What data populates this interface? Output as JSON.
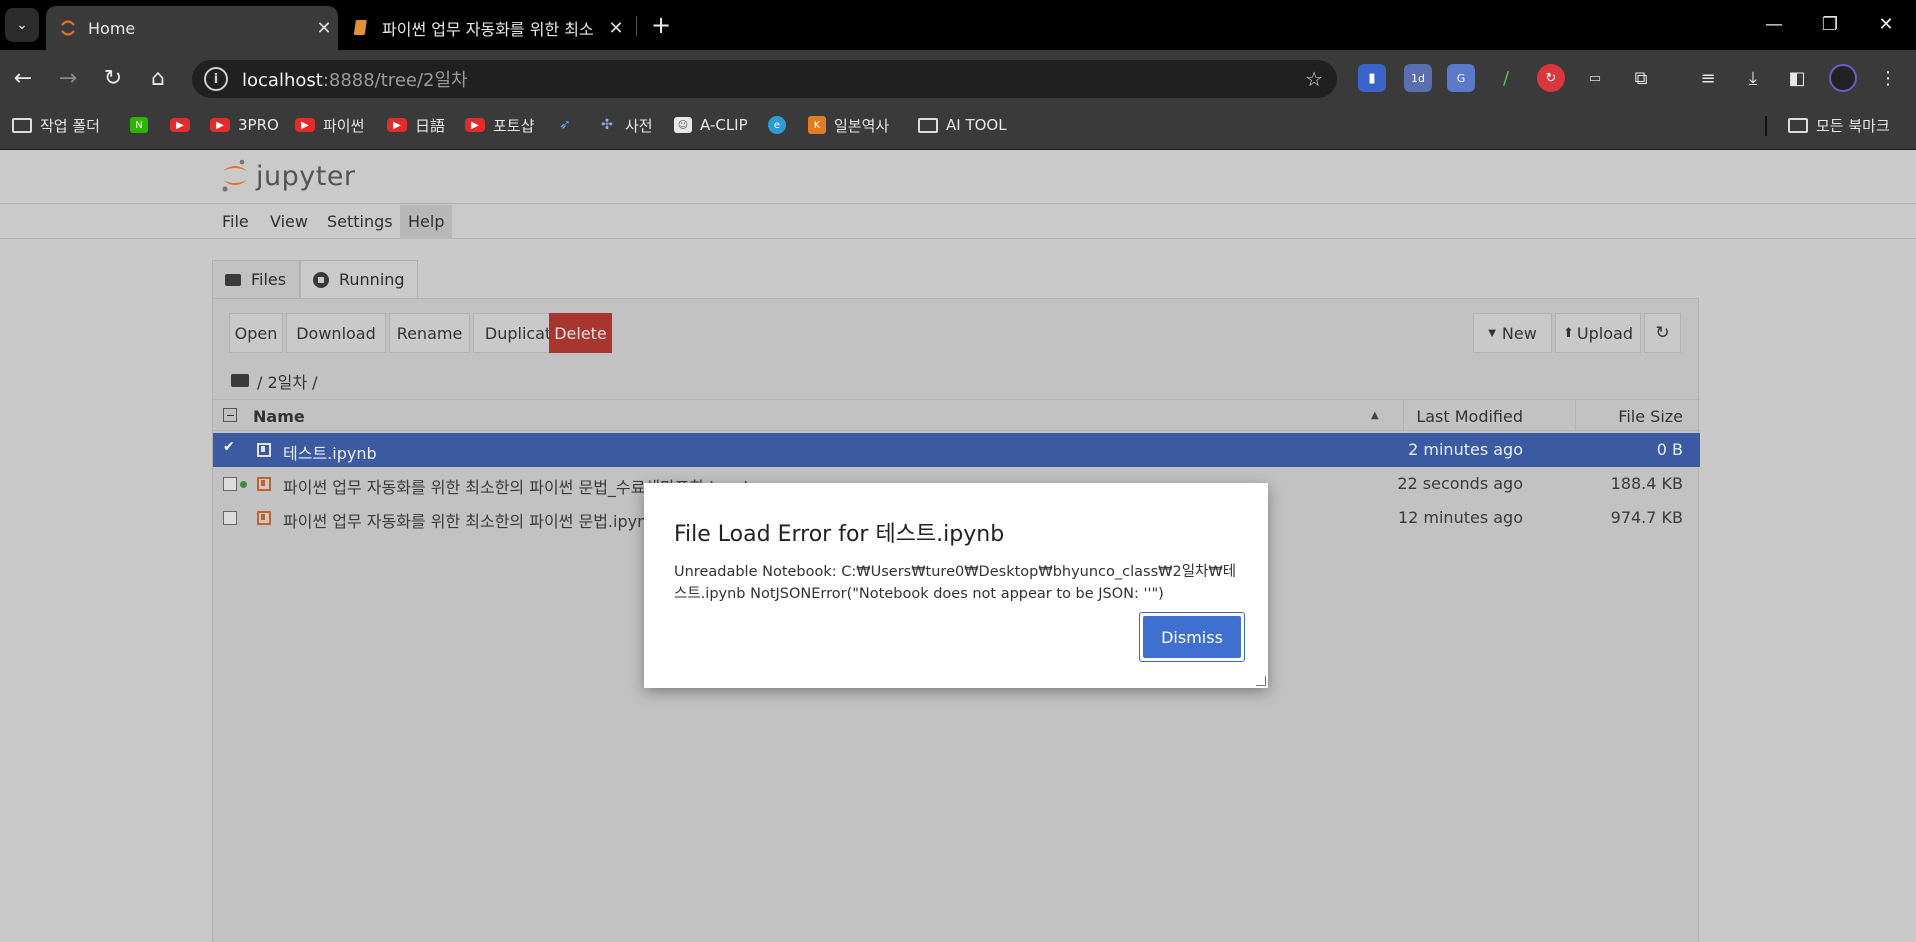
{
  "browser": {
    "tabs": [
      {
        "title": "Home",
        "active": true
      },
      {
        "title": "파이썬 업무 자동화를 위한 최소",
        "active": false
      }
    ],
    "url_host": "localhost",
    "url_path": ":8888/tree/2일차",
    "bookmarks": [
      {
        "label": "작업 폴더",
        "icon": "folder-icon"
      },
      {
        "label": "",
        "icon": "naver-icon"
      },
      {
        "label": "",
        "icon": "youtube-icon"
      },
      {
        "label": "3PRO",
        "icon": "youtube-icon"
      },
      {
        "label": "파이썬",
        "icon": "youtube-icon"
      },
      {
        "label": "日語",
        "icon": "youtube-icon"
      },
      {
        "label": "포토샵",
        "icon": "youtube-icon"
      },
      {
        "label": "",
        "icon": "bird-icon"
      },
      {
        "label": "사전",
        "icon": "dictionary-icon"
      },
      {
        "label": "A-CLIP",
        "icon": "aclip-icon"
      },
      {
        "label": "",
        "icon": "edge-icon"
      },
      {
        "label": "일본역사",
        "icon": "k-icon"
      },
      {
        "label": "AI TOOL",
        "icon": "folder-icon"
      }
    ],
    "all_bookmarks": "모든 북마크"
  },
  "jupyter": {
    "logo": "jupyter",
    "menu": [
      "File",
      "View",
      "Settings",
      "Help"
    ],
    "tabs": [
      "Files",
      "Running"
    ],
    "toolbar": {
      "open": "Open",
      "download": "Download",
      "rename": "Rename",
      "duplicate": "Duplicate",
      "delete": "Delete",
      "new": "New",
      "upload": "Upload"
    },
    "breadcrumb": "/ 2일차 /",
    "columns": {
      "name": "Name",
      "last_modified": "Last Modified",
      "file_size": "File Size"
    },
    "files": [
      {
        "name": "테스트.ipynb",
        "modified": "2 minutes ago",
        "size": "0 B",
        "selected": true,
        "running": false
      },
      {
        "name": "파이썬 업무 자동화를 위한 최소한의 파이썬 문법_수료생만포함.ipynb",
        "modified": "22 seconds ago",
        "size": "188.4 KB",
        "selected": false,
        "running": true
      },
      {
        "name": "파이썬 업무 자동화를 위한 최소한의 파이썬 문법.ipynb",
        "modified": "12 minutes ago",
        "size": "974.7 KB",
        "selected": false,
        "running": false
      }
    ]
  },
  "dialog": {
    "title": "File Load Error for 테스트.ipynb",
    "message": "Unreadable Notebook: C:₩Users₩ture0₩Desktop₩bhyunco_class₩2일차₩테스트.ipynb NotJSONError(\"Notebook does not appear to be JSON: ''\")",
    "button": "Dismiss"
  },
  "colors": {
    "accent": "#3f6fd0",
    "selected_row": "#3b5aa1",
    "delete": "#a8362f",
    "jupyter_orange": "#e46e2e"
  }
}
